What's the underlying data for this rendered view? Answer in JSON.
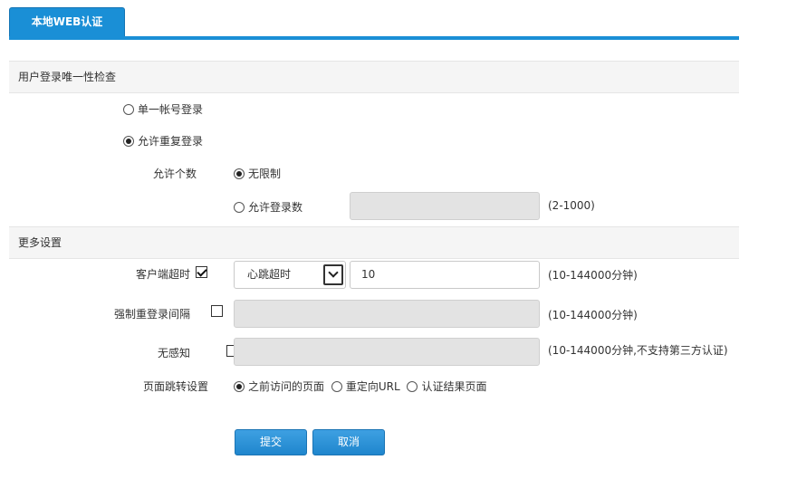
{
  "tab": {
    "label": "本地WEB认证"
  },
  "section_login": {
    "title": "用户登录唯一性检查",
    "single_account": "单一帐号登录",
    "allow_duplicate": "允许重复登录",
    "allow_count_label": "允许个数",
    "unlimited": "无限制",
    "allowed_logins": "允许登录数",
    "allowed_logins_value": "",
    "allowed_logins_hint": "(2-1000)"
  },
  "section_more": {
    "title": "更多设置",
    "client_timeout_label": "客户端超时",
    "client_timeout_type": "心跳超时",
    "client_timeout_value": "10",
    "client_timeout_hint": "(10-144000分钟)",
    "force_relogin_label": "强制重登录间隔",
    "force_relogin_value": "",
    "force_relogin_hint": "(10-144000分钟)",
    "no_perception_label": "无感知",
    "no_perception_value": "",
    "no_perception_hint": "(10-144000分钟,不支持第三方认证)",
    "redirect_label": "页面跳转设置",
    "redirect_opt1": "之前访问的页面",
    "redirect_opt2": "重定向URL",
    "redirect_opt3": "认证结果页面"
  },
  "buttons": {
    "submit": "提交",
    "cancel": "取消"
  },
  "colors": {
    "accent": "#1a8fd6",
    "disabled_field": "#e3e3e3",
    "section_bg": "#f5f5f5"
  }
}
